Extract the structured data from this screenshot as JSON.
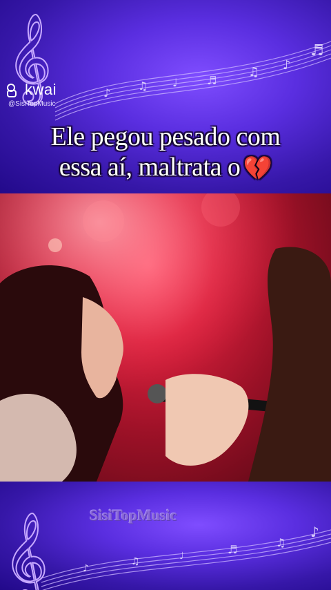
{
  "app": {
    "brand_name": "kwai",
    "handle": "@SisiTopMusic"
  },
  "caption": {
    "line1": "Ele pegou pesado com",
    "line2": "essa aí, maltrata o",
    "emoji": "💔"
  },
  "video": {
    "scene": "performance"
  },
  "watermark": {
    "text": "SisiTopMusic"
  },
  "icons": {
    "brand": "kwai-logo-icon",
    "treble_clef": "treble-clef-icon",
    "music_note": "music-note-icon",
    "heart": "broken-heart-icon"
  },
  "colors": {
    "background": "#4b23c9",
    "accent": "#7f4dff",
    "caption_text": "#ffffff",
    "video_red": "#d8203c"
  }
}
